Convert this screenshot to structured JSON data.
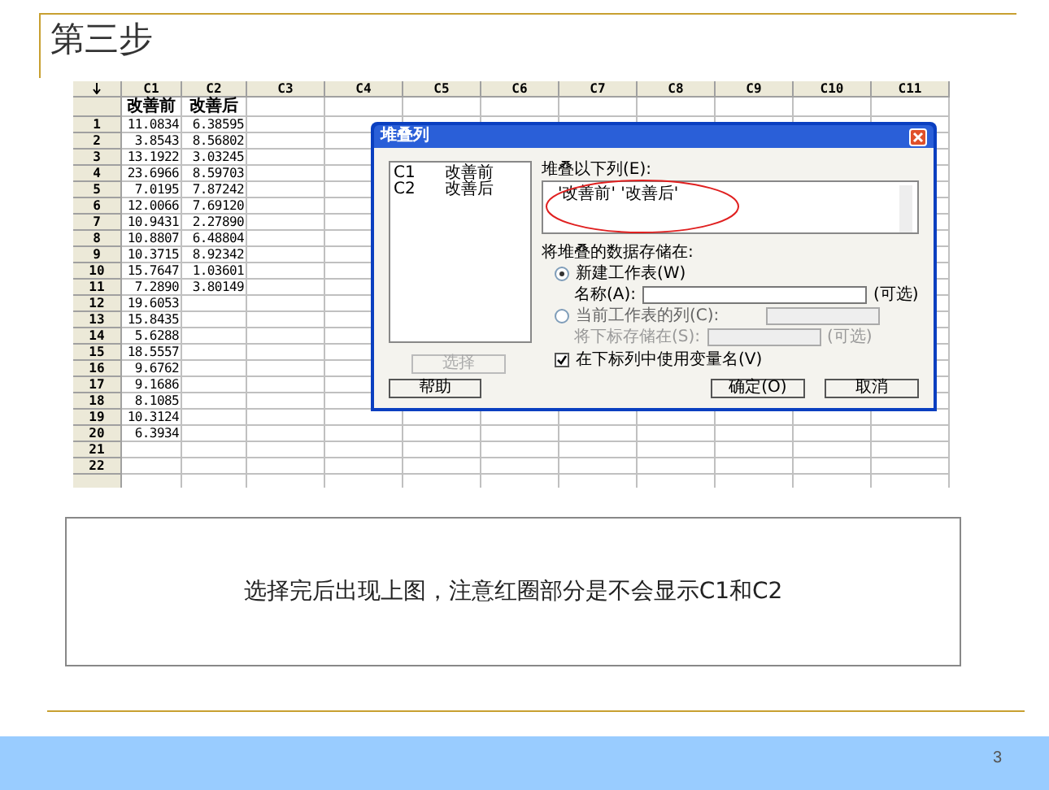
{
  "slide": {
    "title": "第三步",
    "page_number": "3"
  },
  "worksheet": {
    "columns": [
      {
        "label": "C1",
        "name": "改善前"
      },
      {
        "label": "C2",
        "name": "改善后"
      },
      {
        "label": "C3"
      },
      {
        "label": "C4"
      },
      {
        "label": "C5"
      },
      {
        "label": "C6"
      },
      {
        "label": "C7"
      },
      {
        "label": "C8"
      },
      {
        "label": "C9"
      },
      {
        "label": "C10"
      },
      {
        "label": "C11"
      }
    ],
    "rows": [
      {
        "number": "1",
        "cells": [
          "11.0834",
          "6.38595"
        ]
      },
      {
        "number": "2",
        "cells": [
          "3.8543",
          "8.56802"
        ]
      },
      {
        "number": "3",
        "cells": [
          "13.1922",
          "3.03245"
        ]
      },
      {
        "number": "4",
        "cells": [
          "23.6966",
          "8.59703"
        ]
      },
      {
        "number": "5",
        "cells": [
          "7.0195",
          "7.87242"
        ]
      },
      {
        "number": "6",
        "cells": [
          "12.0066",
          "7.69120"
        ]
      },
      {
        "number": "7",
        "cells": [
          "10.9431",
          "2.27890"
        ]
      },
      {
        "number": "8",
        "cells": [
          "10.8807",
          "6.48804"
        ]
      },
      {
        "number": "9",
        "cells": [
          "10.3715",
          "8.92342"
        ]
      },
      {
        "number": "10",
        "cells": [
          "15.7647",
          "1.03601"
        ]
      },
      {
        "number": "11",
        "cells": [
          "7.2890",
          "3.80149"
        ]
      },
      {
        "number": "12",
        "cells": [
          "19.6053"
        ]
      },
      {
        "number": "13",
        "cells": [
          "15.8435"
        ]
      },
      {
        "number": "14",
        "cells": [
          "5.6288"
        ]
      },
      {
        "number": "15",
        "cells": [
          "18.5557"
        ]
      },
      {
        "number": "16",
        "cells": [
          "9.6762"
        ]
      },
      {
        "number": "17",
        "cells": [
          "9.1686"
        ]
      },
      {
        "number": "18",
        "cells": [
          "8.1085"
        ]
      },
      {
        "number": "19",
        "cells": [
          "10.3124"
        ]
      },
      {
        "number": "20",
        "cells": [
          "6.3934"
        ]
      },
      {
        "number": "21",
        "cells": []
      },
      {
        "number": "22",
        "cells": []
      }
    ]
  },
  "dialog": {
    "title": "堆叠列",
    "variables": [
      {
        "column": "C1",
        "name": "改善前"
      },
      {
        "column": "C2",
        "name": "改善后"
      }
    ],
    "select_button": {
      "label": "选择",
      "disabled": true
    },
    "stack_label": "堆叠以下列(E):",
    "stack_value": "'改善前' '改善后'",
    "stack_circled": true,
    "store_label": "将堆叠的数据存储在:",
    "options": [
      {
        "label": "新建工作表(W)",
        "selected": true,
        "field_label": "名称(A):",
        "hint": "(可选)"
      },
      {
        "label": "当前工作表的列(C):",
        "selected": false,
        "field_label": "将下标存储在(S):",
        "hint": "(可选)"
      }
    ],
    "use_names": {
      "label": "在下标列中使用变量名(V)",
      "checked": true
    },
    "buttons": [
      {
        "kind": "help",
        "label": "帮助"
      },
      {
        "kind": "ok",
        "label": "确定(O)"
      },
      {
        "kind": "cancel",
        "label": "取消"
      }
    ]
  },
  "caption": "选择完后出现上图，注意红圈部分是不会显示C1和C2"
}
